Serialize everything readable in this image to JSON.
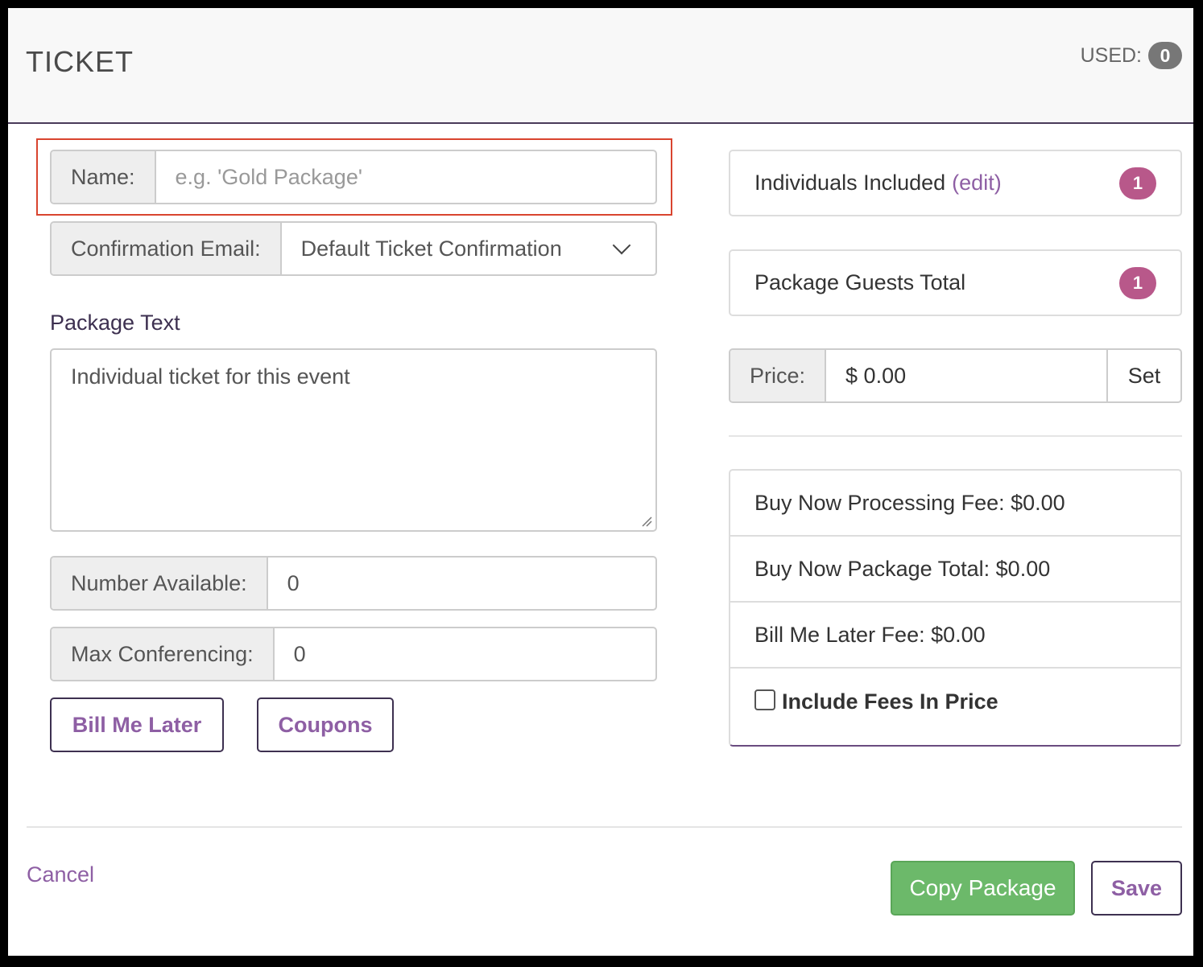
{
  "header": {
    "title": "TICKET",
    "used_label": "USED:",
    "used_count": "0"
  },
  "form": {
    "name_label": "Name:",
    "name_placeholder": "e.g. 'Gold Package'",
    "confirmation_label": "Confirmation Email:",
    "confirmation_value": "Default Ticket Confirmation",
    "package_text_label": "Package Text",
    "package_text_value": "Individual ticket for this event",
    "number_available_label": "Number Available:",
    "number_available_value": "0",
    "max_conferencing_label": "Max Conferencing:",
    "max_conferencing_value": "0",
    "bill_me_later_button": "Bill Me Later",
    "coupons_button": "Coupons"
  },
  "summary": {
    "individuals_label": "Individuals Included",
    "individuals_edit": "(edit)",
    "individuals_count": "1",
    "guests_label": "Package Guests Total",
    "guests_count": "1",
    "price_label": "Price:",
    "price_value": "$ 0.00",
    "set_button": "Set",
    "fees": [
      "Buy Now Processing Fee: $0.00",
      "Buy Now Package Total: $0.00",
      "Bill Me Later Fee: $0.00"
    ],
    "include_fees_label": "Include Fees In Price"
  },
  "footer": {
    "cancel": "Cancel",
    "copy_package": "Copy Package",
    "save": "Save"
  },
  "colors": {
    "accent_purple": "#8e5fa4",
    "badge_pink": "#b8588a",
    "green": "#6cb96a",
    "highlight_red": "#d9442f"
  }
}
